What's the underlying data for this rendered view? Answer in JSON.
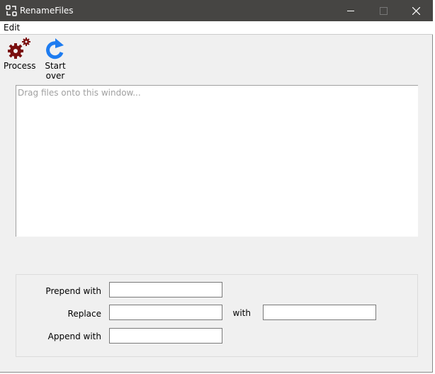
{
  "window": {
    "title": "RenameFiles"
  },
  "menu": {
    "edit": "Edit"
  },
  "toolbar": {
    "process": "Process",
    "start_over": "Start over"
  },
  "drop_area": {
    "placeholder": "Drag files onto this window..."
  },
  "form": {
    "prepend_label": "Prepend with",
    "prepend_value": "",
    "replace_label": "Replace",
    "replace_value": "",
    "with_label": "with",
    "with_value": "",
    "append_label": "Append with",
    "append_value": ""
  },
  "colors": {
    "process_icon": "#7a0f0f",
    "start_over_icon": "#1e7cf0",
    "titlebar": "#464543"
  }
}
